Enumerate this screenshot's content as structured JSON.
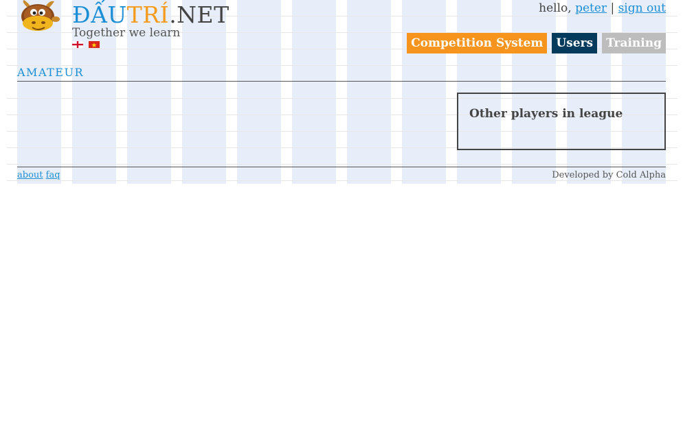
{
  "brand": {
    "part1": "ĐẤU",
    "part2": "TRÍ",
    "part3": ".NET",
    "tagline": "Together we learn"
  },
  "languages": [
    {
      "name": "English",
      "icon": "england-flag-icon"
    },
    {
      "name": "Vietnamese",
      "icon": "vietnam-flag-icon"
    }
  ],
  "user": {
    "greeting": "hello,",
    "username": "peter",
    "separator": "|",
    "signout": "sign out"
  },
  "nav": {
    "competition": "Competition System",
    "users": "Users",
    "training": "Training"
  },
  "section": {
    "title": "AMATEUR"
  },
  "panel": {
    "title": "Other players in league"
  },
  "footer": {
    "about": "about",
    "faq": "faq",
    "credit": "Developed by Cold Alpha"
  },
  "colors": {
    "brand_blue": "#1a8fd6",
    "brand_orange": "#f59a1b",
    "nav_competition": "#f7941d",
    "nav_users": "#043a5c",
    "nav_training": "#bdbdbd"
  }
}
